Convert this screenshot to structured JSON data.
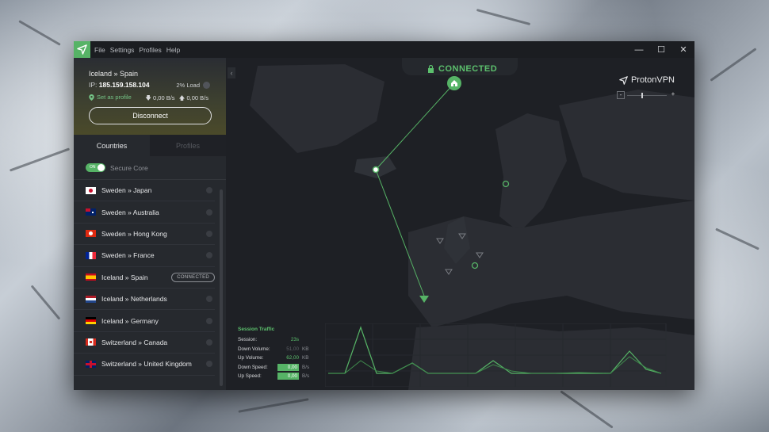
{
  "window": {
    "menu": [
      "File",
      "Settings",
      "Profiles",
      "Help"
    ],
    "controls": {
      "minimize": "—",
      "maximize": "☐",
      "close": "✕"
    }
  },
  "status": {
    "route": "Iceland » Spain",
    "ip_label": "IP:",
    "ip_value": "185.159.158.104",
    "load": "2% Load",
    "set_profile": "Set as profile",
    "down_speed": "0,00 B/s",
    "up_speed": "0,00 B/s",
    "disconnect_label": "Disconnect"
  },
  "tabs": {
    "countries": "Countries",
    "profiles": "Profiles"
  },
  "secure_core": {
    "toggle": "ON",
    "label": "Secure Core"
  },
  "servers": [
    {
      "label": "Sweden » Japan",
      "flag": "jp"
    },
    {
      "label": "Sweden » Australia",
      "flag": "au"
    },
    {
      "label": "Sweden » Hong Kong",
      "flag": "hk"
    },
    {
      "label": "Sweden » France",
      "flag": "fr"
    },
    {
      "label": "Iceland » Spain",
      "flag": "es",
      "badge": "CONNECTED"
    },
    {
      "label": "Iceland » Netherlands",
      "flag": "nl"
    },
    {
      "label": "Iceland » Germany",
      "flag": "de"
    },
    {
      "label": "Switzerland » Canada",
      "flag": "ca"
    },
    {
      "label": "Switzerland » United Kingdom",
      "flag": "gb"
    }
  ],
  "map": {
    "connected_label": "CONNECTED",
    "brand": "ProtonVPN",
    "zoom_minus": "-",
    "zoom_plus": "+",
    "zoom_level": 0.35
  },
  "traffic": {
    "title": "Session Traffic",
    "session_label": "Session:",
    "session_value": "23s",
    "down_volume_label": "Down Volume:",
    "down_volume_value": "51,00",
    "down_volume_unit": "KB",
    "up_volume_label": "Up Volume:",
    "up_volume_value": "62,00",
    "up_volume_unit": "KB",
    "down_speed_label": "Down Speed:",
    "down_speed_value": "0,00",
    "down_speed_unit": "B/s",
    "up_speed_label": "Up Speed:",
    "up_speed_value": "0,00",
    "up_speed_unit": "B/s"
  },
  "colors": {
    "accent": "#56b366",
    "background": "#1e2025",
    "sidebar": "#26292e"
  }
}
